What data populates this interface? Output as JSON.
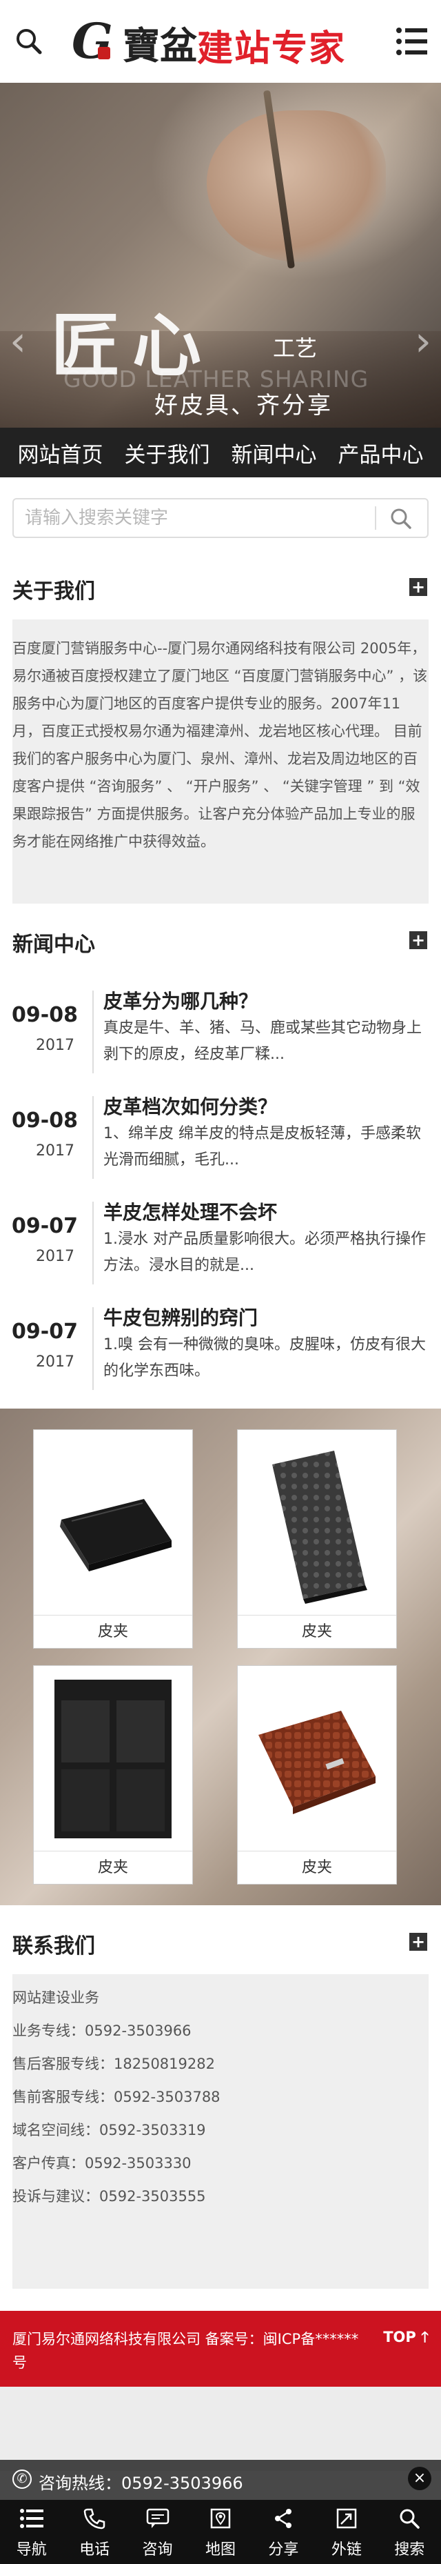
{
  "header": {
    "logo_left": "G",
    "logo_mid": "寶盆",
    "logo_red": "建站专家"
  },
  "banner": {
    "big_text": "匠心",
    "small_text": "工艺",
    "english": "GOOD LEATHER SHARING",
    "tagline": "好皮具、齐分享"
  },
  "nav": [
    "网站首页",
    "关于我们",
    "新闻中心",
    "产品中心"
  ],
  "search": {
    "placeholder": "请输入搜索关键字"
  },
  "about": {
    "title": "关于我们",
    "paragraphs": [
      "百度厦门营销服务中心--厦门易尔通网络科技有限公司 2005年，易尔通被百度授权建立了厦门地区 “百度厦门营销服务中心” ，该服务中心为厦门地区的百度客户提供专业的服务。2007年11月，百度正式授权易尔通为福建漳州、龙岩地区核心代理。 目前我们的客户服务中心为厦门、泉州、漳州、龙岩及周边地区的百度客户提供 “咨询服务” 、 “开户服务” 、 “关键字管理 ” 到 “效果跟踪报告” 方面提供服务。让客户充分体验产品加上专业的服务才能在网络推广中获得效益。"
    ]
  },
  "news": {
    "title": "新闻中心",
    "items": [
      {
        "md": "09-08",
        "yr": "2017",
        "title": "皮革分为哪几种？",
        "desc": "真皮是牛、羊、猪、马、鹿或某些其它动物身上剥下的原皮，经皮革厂糅..."
      },
      {
        "md": "09-08",
        "yr": "2017",
        "title": "皮革档次如何分类？",
        "desc": "1、绵羊皮 绵羊皮的特点是皮板轻薄，手感柔软光滑而细腻，毛孔..."
      },
      {
        "md": "09-07",
        "yr": "2017",
        "title": "羊皮怎样处理不会坏",
        "desc": "1.浸水 对产品质量影响很大。必须严格执行操作方法。浸水目的就是..."
      },
      {
        "md": "09-07",
        "yr": "2017",
        "title": "牛皮包辨别的窍门",
        "desc": "1.嗅 会有一种微微的臭味。皮腥味，仿皮有很大的化学东西味。"
      }
    ]
  },
  "products": {
    "items": [
      {
        "caption": "皮夹",
        "style": "black-fold"
      },
      {
        "caption": "皮夹",
        "style": "pattern-long"
      },
      {
        "caption": "皮夹",
        "style": "black-open"
      },
      {
        "caption": "皮夹",
        "style": "brown-croc"
      }
    ]
  },
  "contact": {
    "title": "联系我们",
    "lines": [
      "网站建设业务",
      "业务专线：0592-3503966",
      "售后客服专线：18250819282",
      "售前客服专线：0592-3503788",
      "域名空间线：0592-3503319",
      "客户传真：0592-3503330",
      "投诉与建议：0592-3503555"
    ]
  },
  "footer": {
    "text": "厦门易尔通网络科技有限公司 备案号：闽ICP备******号",
    "top_label": "TOP"
  },
  "hotline": {
    "label": "咨询热线：0592-3503966"
  },
  "tabbar": [
    {
      "label": "导航",
      "icon": "list-icon"
    },
    {
      "label": "电话",
      "icon": "phone-icon"
    },
    {
      "label": "咨询",
      "icon": "chat-icon"
    },
    {
      "label": "地图",
      "icon": "map-icon"
    },
    {
      "label": "分享",
      "icon": "share-icon"
    },
    {
      "label": "外链",
      "icon": "link-icon"
    },
    {
      "label": "搜索",
      "icon": "search-icon"
    }
  ],
  "colors": {
    "accent_red": "#cc1320",
    "nav_bg": "#222222",
    "tabbar_bg": "#111111"
  }
}
